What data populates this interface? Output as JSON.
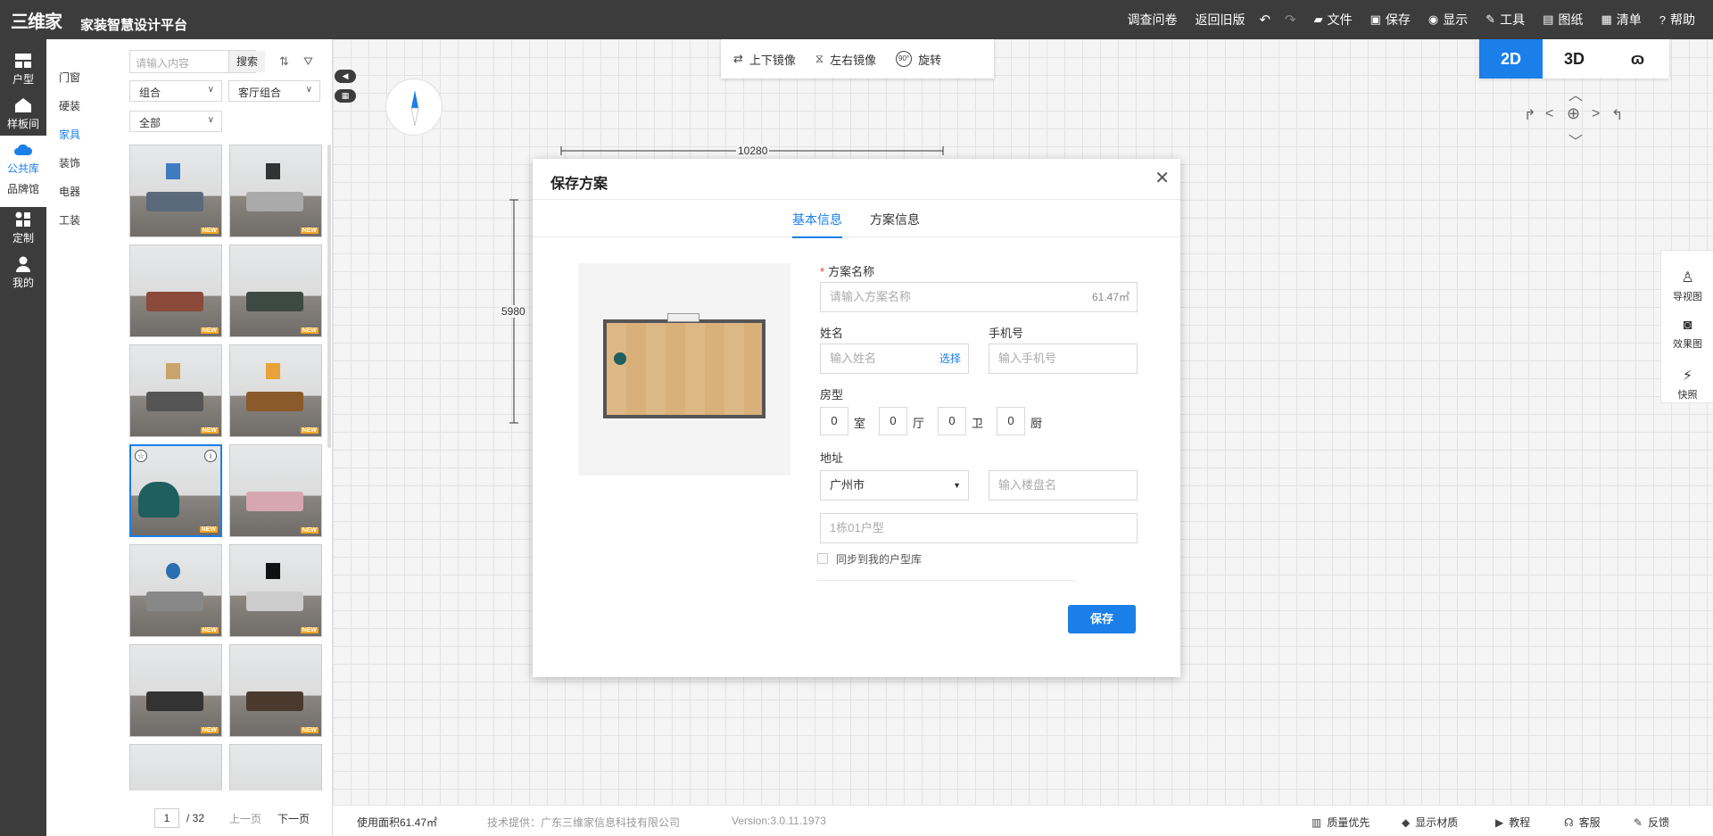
{
  "app": {
    "logo_text": "三维家",
    "title": "家装智慧设计平台"
  },
  "topmenu": {
    "survey": "调查问卷",
    "back_old": "返回旧版",
    "file": "文件",
    "save": "保存",
    "display": "显示",
    "tools": "工具",
    "drawings": "图纸",
    "list": "清单",
    "help": "帮助"
  },
  "leftnav": {
    "items": [
      "户型",
      "样板间",
      "公共库",
      "品牌馆",
      "定制",
      "我的"
    ]
  },
  "categories": [
    "门窗",
    "硬装",
    "家具",
    "装饰",
    "电器",
    "工装"
  ],
  "library": {
    "search_placeholder": "请输入内容",
    "search_button": "搜索",
    "filter1": "组合",
    "filter2": "客厅组合",
    "filter3": "全部",
    "badge": "NEW",
    "page_current": "1",
    "page_total": "/ 32",
    "prev": "上一页",
    "next": "下一页"
  },
  "toolbar": {
    "flip_v": "上下镜像",
    "flip_h": "左右镜像",
    "rotate": "旋转",
    "rotate_badge": "90°"
  },
  "view": {
    "v2d": "2D",
    "v3d": "3D",
    "v_other": "ɷ"
  },
  "canvas": {
    "dim_width": "10280",
    "dim_height": "5980"
  },
  "rightdock": {
    "items": [
      "导视图",
      "效果图",
      "快照"
    ]
  },
  "dialog": {
    "title": "保存方案",
    "tabs": [
      "基本信息",
      "方案信息"
    ],
    "plan_name_label": "方案名称",
    "plan_name_placeholder": "请输入方案名称",
    "area": "61.47㎡",
    "name_label": "姓名",
    "name_placeholder": "输入姓名",
    "name_choose": "选择",
    "phone_label": "手机号",
    "phone_placeholder": "输入手机号",
    "house_type_label": "房型",
    "rooms": [
      {
        "value": "0",
        "unit": "室"
      },
      {
        "value": "0",
        "unit": "厅"
      },
      {
        "value": "0",
        "unit": "卫"
      },
      {
        "value": "0",
        "unit": "厨"
      }
    ],
    "address_label": "地址",
    "city": "广州市",
    "building_placeholder": "输入楼盘名",
    "unit_placeholder": "1栋01户型",
    "sync_label": "同步到我的户型库",
    "save_button": "保存"
  },
  "statusbar": {
    "area": "使用面积61.47㎡",
    "provider": "技术提供：广东三维家信息科技有限公司",
    "version": "Version:3.0.11.1973",
    "quality": "质量优先",
    "material": "显示材质",
    "tutorial": "教程",
    "service": "客服",
    "feedback": "反馈"
  },
  "colors": {
    "accent": "#1a7fe8",
    "topbar": "#3c3c3c",
    "new_badge": "#f5a623"
  }
}
